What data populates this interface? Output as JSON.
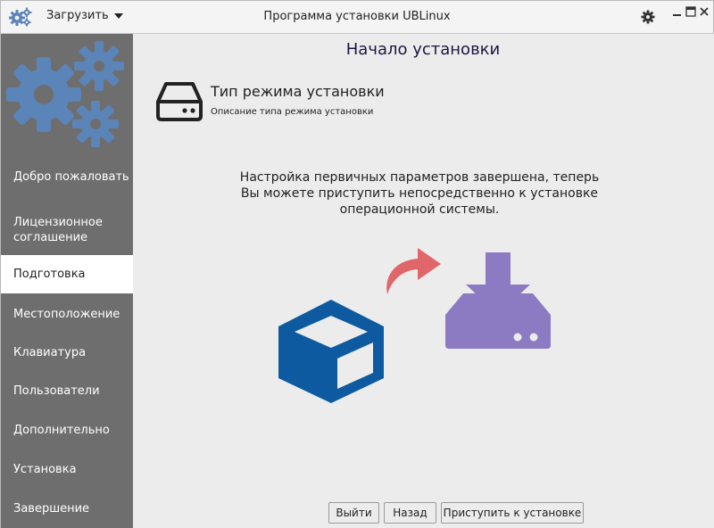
{
  "window": {
    "title": "Программа установки UBLinux",
    "load_menu_label": "Загрузить"
  },
  "sidebar": {
    "items": [
      {
        "label": "Добро пожаловать",
        "active": false
      },
      {
        "label": "Лицензионное соглашение",
        "active": false
      },
      {
        "label": "Подготовка",
        "active": true
      },
      {
        "label": "Местоположение",
        "active": false
      },
      {
        "label": "Клавиатура",
        "active": false
      },
      {
        "label": "Пользователи",
        "active": false
      },
      {
        "label": "Дополнительно",
        "active": false
      },
      {
        "label": "Установка",
        "active": false
      },
      {
        "label": "Завершение",
        "active": false
      }
    ]
  },
  "main": {
    "page_title": "Начало установки",
    "mode_title": "Тип режима установки",
    "mode_description": "Описание типа режима установки",
    "message_lines": [
      "Настройка первичных параметров завершена, теперь",
      "Вы можете приступить непосредственно к установке",
      "операционной системы."
    ]
  },
  "buttons": {
    "exit": "Выйти",
    "back": "Назад",
    "install": "Приступить к установке"
  },
  "colors": {
    "sidebar_bg": "#6e6e6e",
    "gear_blue": "#5b84b8",
    "cube_blue": "#0e5aa0",
    "arrow_red": "#e0666a",
    "install_purple": "#8c7bc3"
  },
  "icons": {
    "app": "gears-icon",
    "settings": "gear-icon",
    "mode": "drive-icon",
    "package": "cube-icon",
    "arrow": "curved-arrow-icon",
    "install": "download-drive-icon"
  }
}
